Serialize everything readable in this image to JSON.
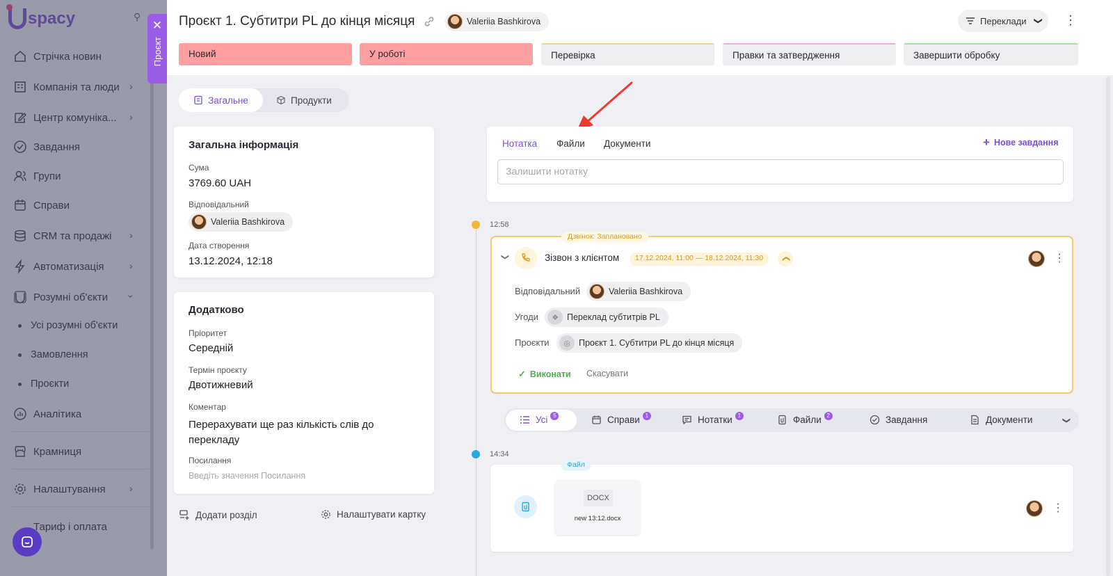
{
  "sidebar": {
    "logo": "spacy",
    "items": [
      "Стрічка новин",
      "Компанія та люди",
      "Центр комуніка...",
      "Завдання",
      "Групи",
      "Справи",
      "CRM та продажі",
      "Автоматизація",
      "Розумні об'єкти"
    ],
    "sub_items": [
      "Усі розумні об'єкти",
      "Замовлення",
      "Проєкти"
    ],
    "bottom_items": [
      "Аналітика",
      "Крамниця",
      "Налаштування",
      "Тариф і оплата"
    ]
  },
  "project_tab": "Проєкт",
  "header": {
    "title": "Проєкт 1. Субтитри PL до кінця місяця",
    "owner": "Valeriia Bashkirova",
    "pipeline": "Переклади"
  },
  "stages": [
    {
      "label": "Новий",
      "color": "#ff9f9f"
    },
    {
      "label": "У роботі",
      "color": "#ff9f9f"
    },
    {
      "label": "Перевірка",
      "color": "#f5d58a"
    },
    {
      "label": "Правки та затвердження",
      "color": "#f2a8e0"
    },
    {
      "label": "Завершити обробку",
      "color": "#9be39b"
    }
  ],
  "view_tabs": {
    "general": "Загальне",
    "products": "Продукти"
  },
  "general_info": {
    "title": "Загальна інформація",
    "sum_label": "Сума",
    "sum_value": "3769.60 UAH",
    "responsible_label": "Відповідальний",
    "responsible_value": "Valeriia Bashkirova",
    "created_label": "Дата створення",
    "created_value": "13.12.2024, 12:18"
  },
  "additional": {
    "title": "Додатково",
    "priority_label": "Пріоритет",
    "priority_value": "Середній",
    "term_label": "Термін проєкту",
    "term_value": "Двотижневий",
    "comment_label": "Коментар",
    "comment_value": "Перерахувати ще раз кількість слів до перекладу",
    "link_label": "Посилання",
    "link_placeholder": "Введіть значення Посилання"
  },
  "footer_actions": {
    "add_section": "Додати розділ",
    "configure": "Налаштувати картку"
  },
  "composer": {
    "tabs": [
      "Нотатка",
      "Файли",
      "Документи"
    ],
    "new_task": "Нове завдання",
    "placeholder": "Залишити нотатку"
  },
  "timeline": {
    "item1": {
      "time": "12:58",
      "badge": "Дзвінок: Заплановано",
      "title": "Зізвон з клієнтом",
      "date_range": "17.12.2024, 11:00 — 18.12.2024, 11:30",
      "responsible_label": "Відповідальний",
      "responsible_value": "Valeriia Bashkirova",
      "deals_label": "Угоди",
      "deals_value": "Переклад субтитрів PL",
      "projects_label": "Проєкти",
      "projects_value": "Проєкт 1. Субтитри PL до кінця місяця",
      "done": "Виконати",
      "cancel": "Скасувати"
    },
    "item2": {
      "time": "14:34",
      "badge": "Файл",
      "file_ext": "DOCX",
      "file_name": "new 13:12.docx"
    }
  },
  "filters": [
    {
      "label": "Усі",
      "count": "5"
    },
    {
      "label": "Справи",
      "count": "1"
    },
    {
      "label": "Нотатки",
      "count": "1"
    },
    {
      "label": "Файли",
      "count": "2"
    },
    {
      "label": "Завдання",
      "count": ""
    },
    {
      "label": "Документи",
      "count": ""
    }
  ],
  "colors": {
    "accent": "#9b5de5",
    "call_orange": "#f5b733",
    "file_blue": "#29a8e0",
    "arrow_red": "#ee3a2c"
  }
}
